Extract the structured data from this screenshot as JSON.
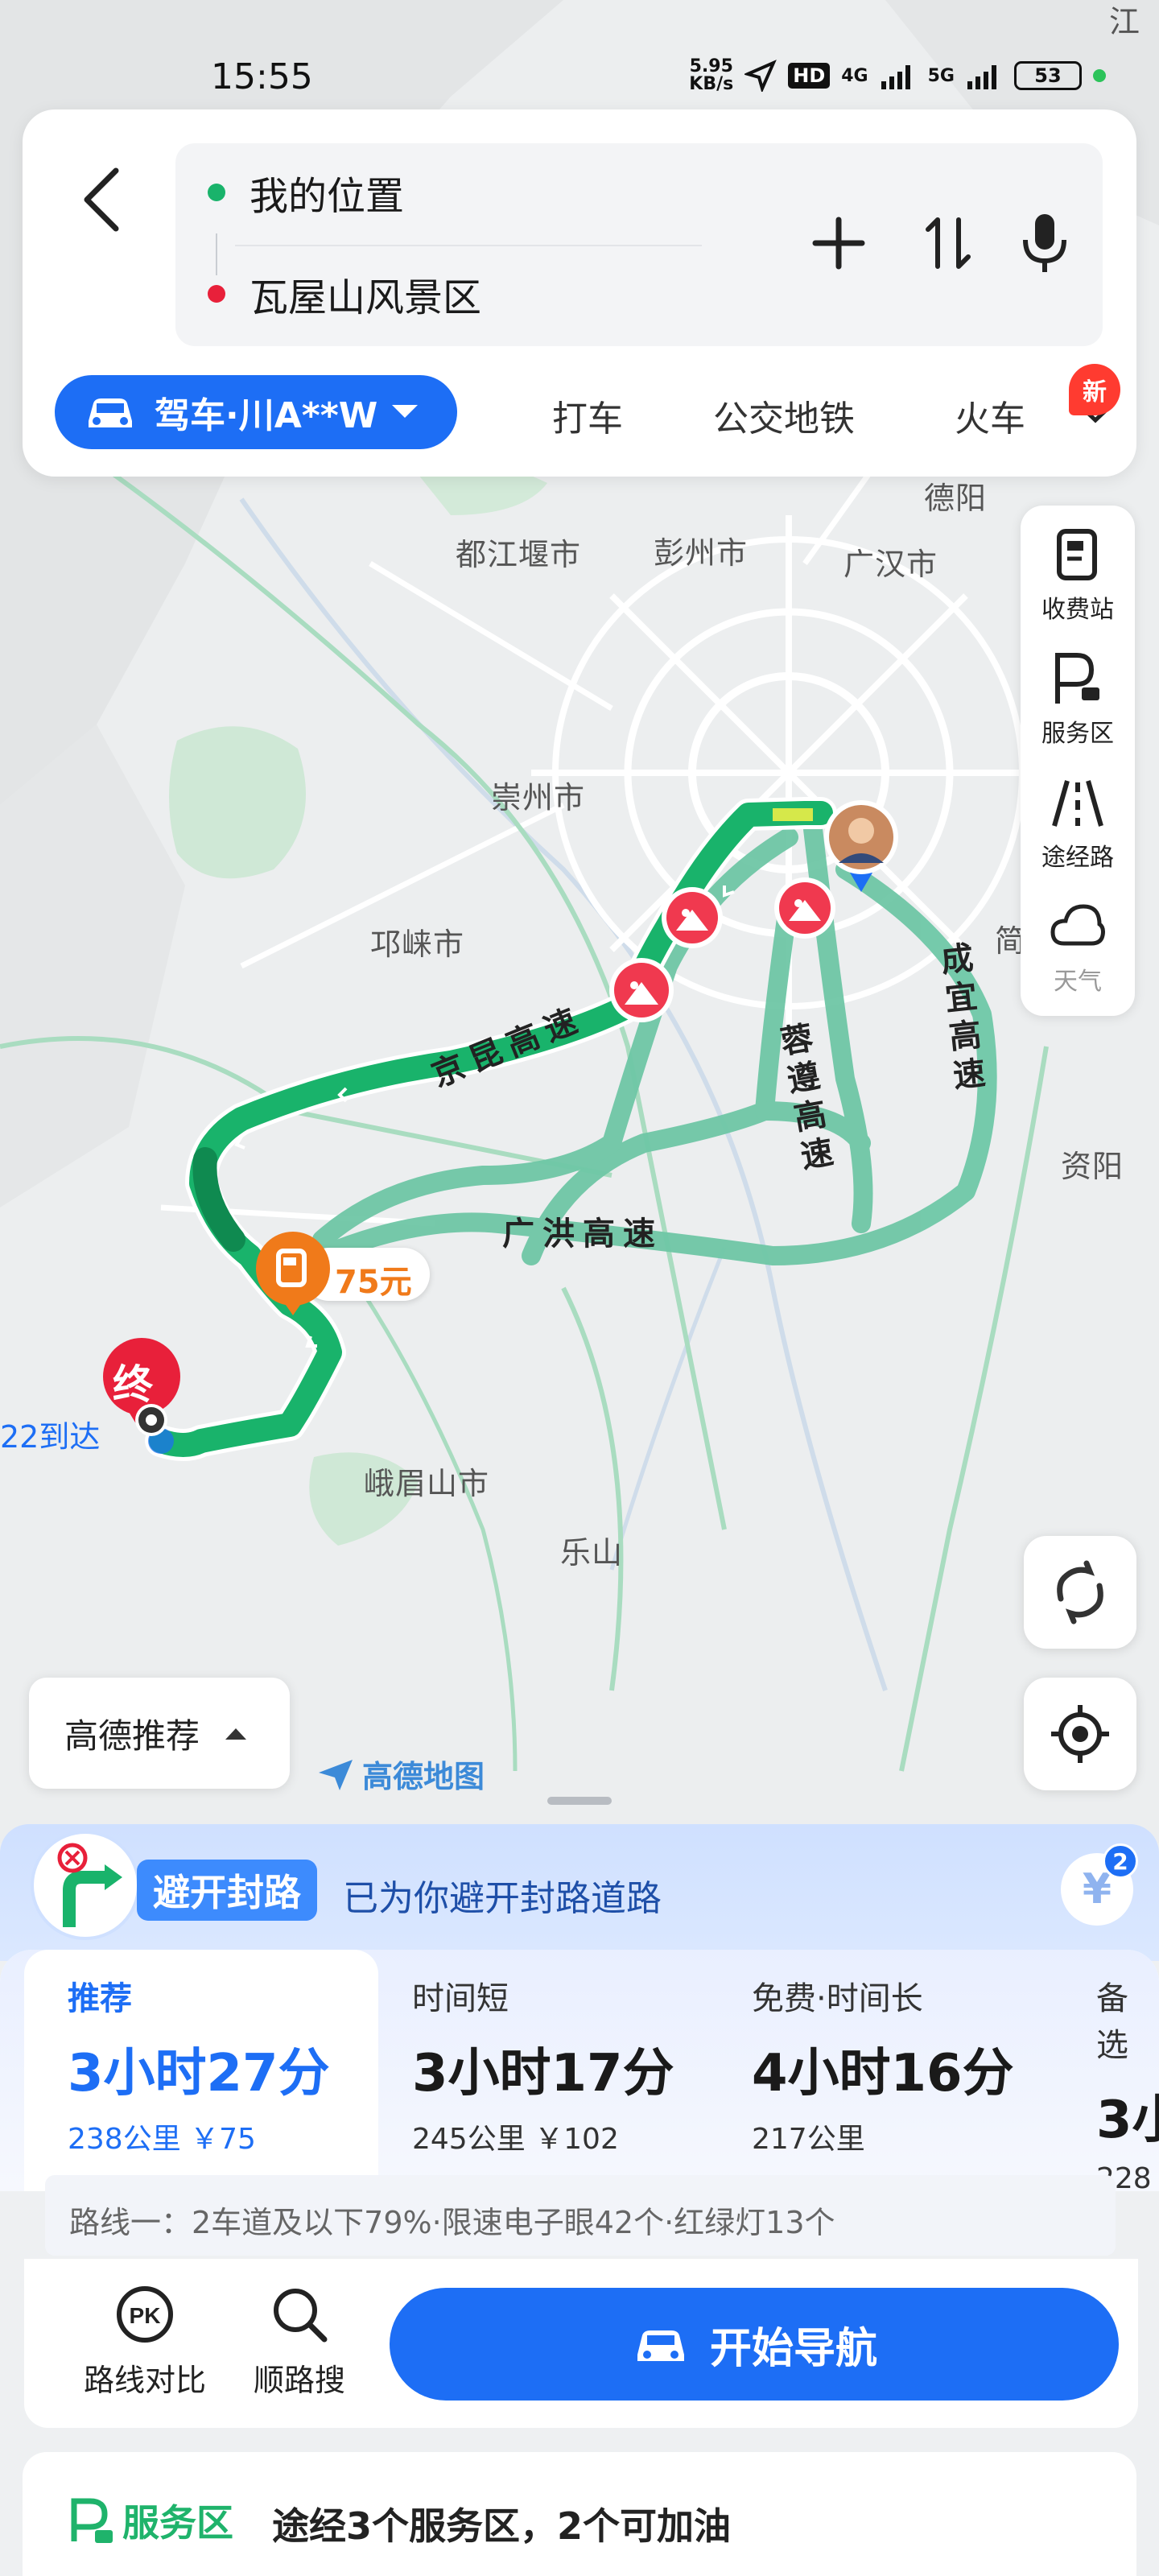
{
  "status_bar": {
    "time": "15:55",
    "net_speed_top": "5.95",
    "net_speed_bottom": "KB/s",
    "hd": "HD",
    "sig1": "4G",
    "sig2": "5G",
    "battery": "53"
  },
  "search": {
    "origin": "我的位置",
    "destination": "瓦屋山风景区"
  },
  "modes": {
    "active": "驾车·川A**W",
    "tabs": [
      "打车",
      "公交地铁",
      "火车"
    ],
    "new_badge": "新"
  },
  "map": {
    "cities": [
      "德阳",
      "都江堰市",
      "彭州市",
      "广汉市",
      "崇州市",
      "邛崃市",
      "资阳",
      "峨眉山市",
      "乐山",
      "简"
    ],
    "roads": [
      "京昆高速",
      "广洪高速",
      "蓉遵高速",
      "成宜高速"
    ],
    "toll_price": "75元",
    "end_marker": "终",
    "arrive_label": "22到达",
    "corner_label": "江",
    "logo_text": "高德地图"
  },
  "tools": [
    {
      "label": "收费站",
      "icon": "toll-station-icon"
    },
    {
      "label": "服务区",
      "icon": "service-area-icon"
    },
    {
      "label": "途经路",
      "icon": "road-icon"
    },
    {
      "label": "天气",
      "icon": "weather-icon"
    }
  ],
  "prefer": {
    "label": "高德推荐"
  },
  "banner": {
    "tag": "避开封路",
    "text": "已为你避开封路道路",
    "coin_symbol": "¥",
    "coin_count": "2"
  },
  "routes": [
    {
      "tag": "推荐",
      "time": "3小时27分",
      "sub": "238公里 ￥75"
    },
    {
      "tag": "时间短",
      "time": "3小时17分",
      "sub": "245公里 ￥102"
    },
    {
      "tag": "免费·时间长",
      "time": "4小时16分",
      "sub": "217公里"
    },
    {
      "tag": "备选",
      "time": "3小",
      "sub": "228"
    }
  ],
  "route_desc": "路线一：2车道及以下79%·限速电子眼42个·红绿灯13个",
  "actions": {
    "compare": "路线对比",
    "search_along": "顺路搜",
    "navigate": "开始导航",
    "pk": "PK"
  },
  "service": {
    "tag": "服务区",
    "text": "途经3个服务区，2个可加油"
  },
  "colors": {
    "accent": "#1d6ef5",
    "route_main": "#19b36b",
    "route_alt": "#6fc7a6",
    "destination": "#e8203a",
    "toll": "#f07a1a"
  }
}
